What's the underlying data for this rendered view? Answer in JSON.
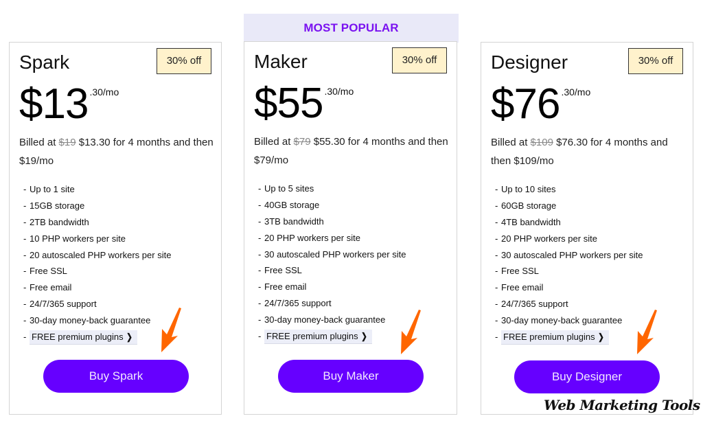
{
  "popular_banner": "MOST POPULAR",
  "plans": [
    {
      "name": "Spark",
      "badge": "30% off",
      "price_whole": "$13",
      "price_sup": ".30/mo",
      "billing_prefix": "Billed at",
      "billing_original": "$19",
      "billing_rest": "$13.30 for 4 months and then $19/mo",
      "features": [
        "Up to 1 site",
        "15GB storage",
        "2TB bandwidth",
        "10 PHP workers per site",
        "20 autoscaled PHP workers per site",
        "Free SSL",
        "Free email",
        "24/7/365 support",
        "30-day money-back guarantee"
      ],
      "plugins_link": "FREE premium plugins",
      "button": "Buy Spark"
    },
    {
      "name": "Maker",
      "badge": "30% off",
      "price_whole": "$55",
      "price_sup": ".30/mo",
      "billing_prefix": "Billed at",
      "billing_original": "$79",
      "billing_rest": "$55.30 for 4 months and then $79/mo",
      "features": [
        "Up to 5 sites",
        "40GB storage",
        "3TB bandwidth",
        "20 PHP workers per site",
        "30 autoscaled PHP workers per site",
        "Free SSL",
        "Free email",
        "24/7/365 support",
        "30-day money-back guarantee"
      ],
      "plugins_link": "FREE premium plugins",
      "button": "Buy Maker"
    },
    {
      "name": "Designer",
      "badge": "30% off",
      "price_whole": "$76",
      "price_sup": ".30/mo",
      "billing_prefix": "Billed at",
      "billing_original": "$109",
      "billing_rest": "$76.30 for 4 months and then $109/mo",
      "features": [
        "Up to 10 sites",
        "60GB storage",
        "4TB bandwidth",
        "20 PHP workers per site",
        "30 autoscaled PHP workers per site",
        "Free SSL",
        "Free email",
        "24/7/365 support",
        "30-day money-back guarantee"
      ],
      "plugins_link": "FREE premium plugins",
      "button": "Buy Designer"
    }
  ],
  "list_dash": "-",
  "icons": {
    "plugins_chevron": "chevron-right-icon",
    "annotation_arrow": "arrow-down-left-icon"
  },
  "colors": {
    "accent": "#6600ff",
    "banner_bg": "#e9e9f8",
    "banner_text": "#7a12f0",
    "badge_bg": "#fff2cc",
    "arrow": "#ff6600"
  },
  "watermark": "Web Marketing Tools"
}
